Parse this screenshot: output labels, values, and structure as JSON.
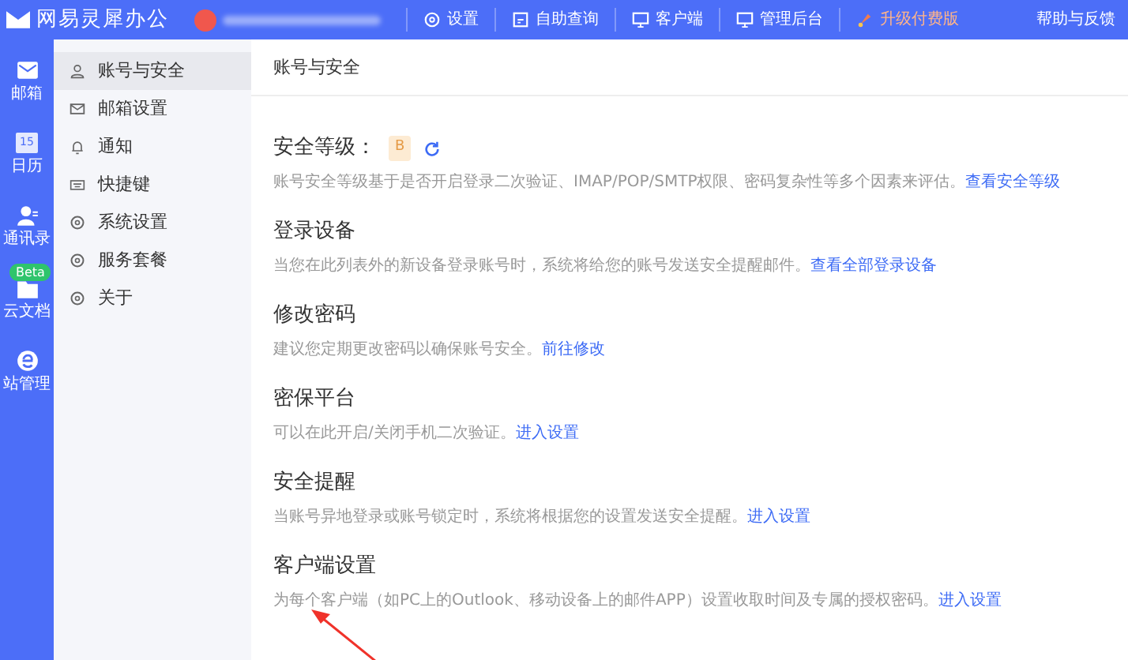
{
  "topbar": {
    "logo": "网易灵犀办公",
    "items": [
      {
        "kind": "gear",
        "label": "设置"
      },
      {
        "kind": "query",
        "label": "自助查询"
      },
      {
        "kind": "monitor",
        "label": "客户端"
      },
      {
        "kind": "monitor",
        "label": "管理后台"
      },
      {
        "kind": "rocket",
        "label": "升级付费版"
      }
    ],
    "help": "帮助与反馈"
  },
  "rail": [
    {
      "kind": "mail",
      "label": "邮箱"
    },
    {
      "kind": "calendar",
      "label": "日历",
      "icon_text": "15"
    },
    {
      "kind": "contacts",
      "label": "通讯录"
    },
    {
      "kind": "docs",
      "label": "云文档",
      "badge": "Beta"
    },
    {
      "kind": "site",
      "label": "站管理"
    }
  ],
  "sidebar": {
    "items": [
      {
        "kind": "user",
        "label": "账号与安全",
        "selected": true
      },
      {
        "kind": "mail",
        "label": "邮箱设置",
        "selected": false
      },
      {
        "kind": "bell",
        "label": "通知",
        "selected": false
      },
      {
        "kind": "keyboard",
        "label": "快捷键",
        "selected": false
      },
      {
        "kind": "gear",
        "label": "系统设置",
        "selected": false
      },
      {
        "kind": "gear",
        "label": "服务套餐",
        "selected": false
      },
      {
        "kind": "gear",
        "label": "关于",
        "selected": false
      }
    ]
  },
  "content": {
    "title": "账号与安全",
    "sections": [
      {
        "title": "安全等级：",
        "grade": "B",
        "description": "账号安全等级基于是否开启登录二次验证、IMAP/POP/SMTP权限、密码复杂性等多个因素来评估。",
        "link": "查看安全等级"
      },
      {
        "title": "登录设备",
        "description": "当您在此列表外的新设备登录账号时，系统将给您的账号发送安全提醒邮件。",
        "link": "查看全部登录设备"
      },
      {
        "title": "修改密码",
        "description": "建议您定期更改密码以确保账号安全。",
        "link": "前往修改"
      },
      {
        "title": "密保平台",
        "description": "可以在此开启/关闭手机二次验证。",
        "link": "进入设置"
      },
      {
        "title": "安全提醒",
        "description": "当账号异地登录或账号锁定时，系统将根据您的设置发送安全提醒。",
        "link": "进入设置"
      },
      {
        "title": "客户端设置",
        "description": "为每个客户端（如PC上的Outlook、移动设备上的邮件APP）设置收取时间及专属的授权密码。",
        "link": "进入设置"
      }
    ]
  }
}
